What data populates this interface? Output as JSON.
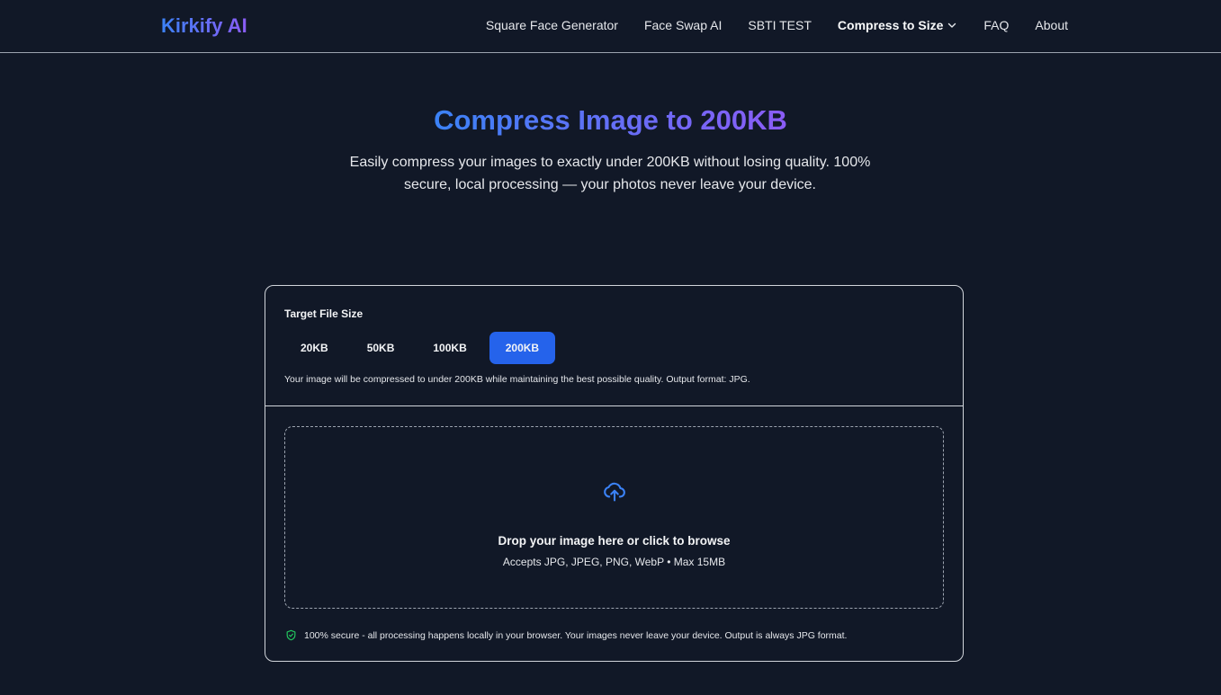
{
  "header": {
    "logo": "Kirkify AI",
    "nav": [
      {
        "label": "Square Face Generator"
      },
      {
        "label": "Face Swap AI"
      },
      {
        "label": "SBTI TEST"
      },
      {
        "label": "Compress to Size"
      },
      {
        "label": "FAQ"
      },
      {
        "label": "About"
      }
    ]
  },
  "hero": {
    "title": "Compress Image to 200KB",
    "subtitle": "Easily compress your images to exactly under 200KB without losing quality. 100% secure, local processing — your photos never leave your device."
  },
  "card": {
    "target_label": "Target File Size",
    "sizes": [
      "20KB",
      "50KB",
      "100KB",
      "200KB"
    ],
    "selected_size": "200KB",
    "note": "Your image will be compressed to under 200KB while maintaining the best possible quality. Output format: JPG.",
    "dropzone": {
      "title": "Drop your image here or click to browse",
      "subtitle": "Accepts JPG, JPEG, PNG, WebP • Max 15MB"
    },
    "secure_note": "100% secure - all processing happens locally in your browser. Your images never leave your device. Output is always JPG format."
  },
  "colors": {
    "background": "#111827",
    "accent": "#2563eb",
    "gradient_start": "#3b82f6",
    "gradient_end": "#8b5cf6",
    "secure_green": "#22c55e"
  },
  "icons": {
    "nav_dropdown": "chevron-down-icon",
    "dropzone": "cloud-upload-icon",
    "secure": "shield-check-icon"
  }
}
